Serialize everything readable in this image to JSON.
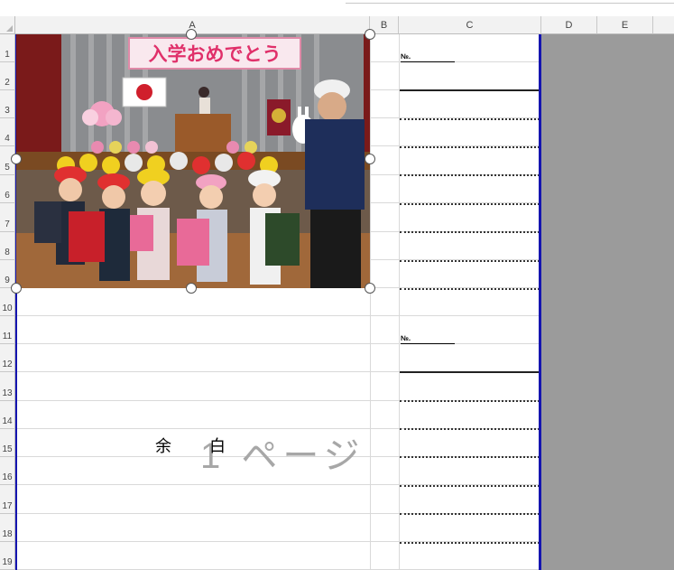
{
  "sheet": {
    "columns": [
      "A",
      "B",
      "C",
      "D",
      "E"
    ],
    "rows": [
      "1",
      "2",
      "3",
      "4",
      "5",
      "6",
      "7",
      "8",
      "9",
      "10",
      "11",
      "12",
      "13",
      "14",
      "15",
      "16",
      "17",
      "18",
      "19"
    ]
  },
  "photo": {
    "banner_text": "入学おめでとう",
    "description_icon": "school-ceremony-photo"
  },
  "cells": {
    "no_label_1": "№.",
    "no_label_2": "№."
  },
  "watermark": {
    "page_text": "1 ページ"
  },
  "margin_text": "余白",
  "colors": {
    "page_border": "#1515b0",
    "outside_area": "#9b9b9b"
  }
}
